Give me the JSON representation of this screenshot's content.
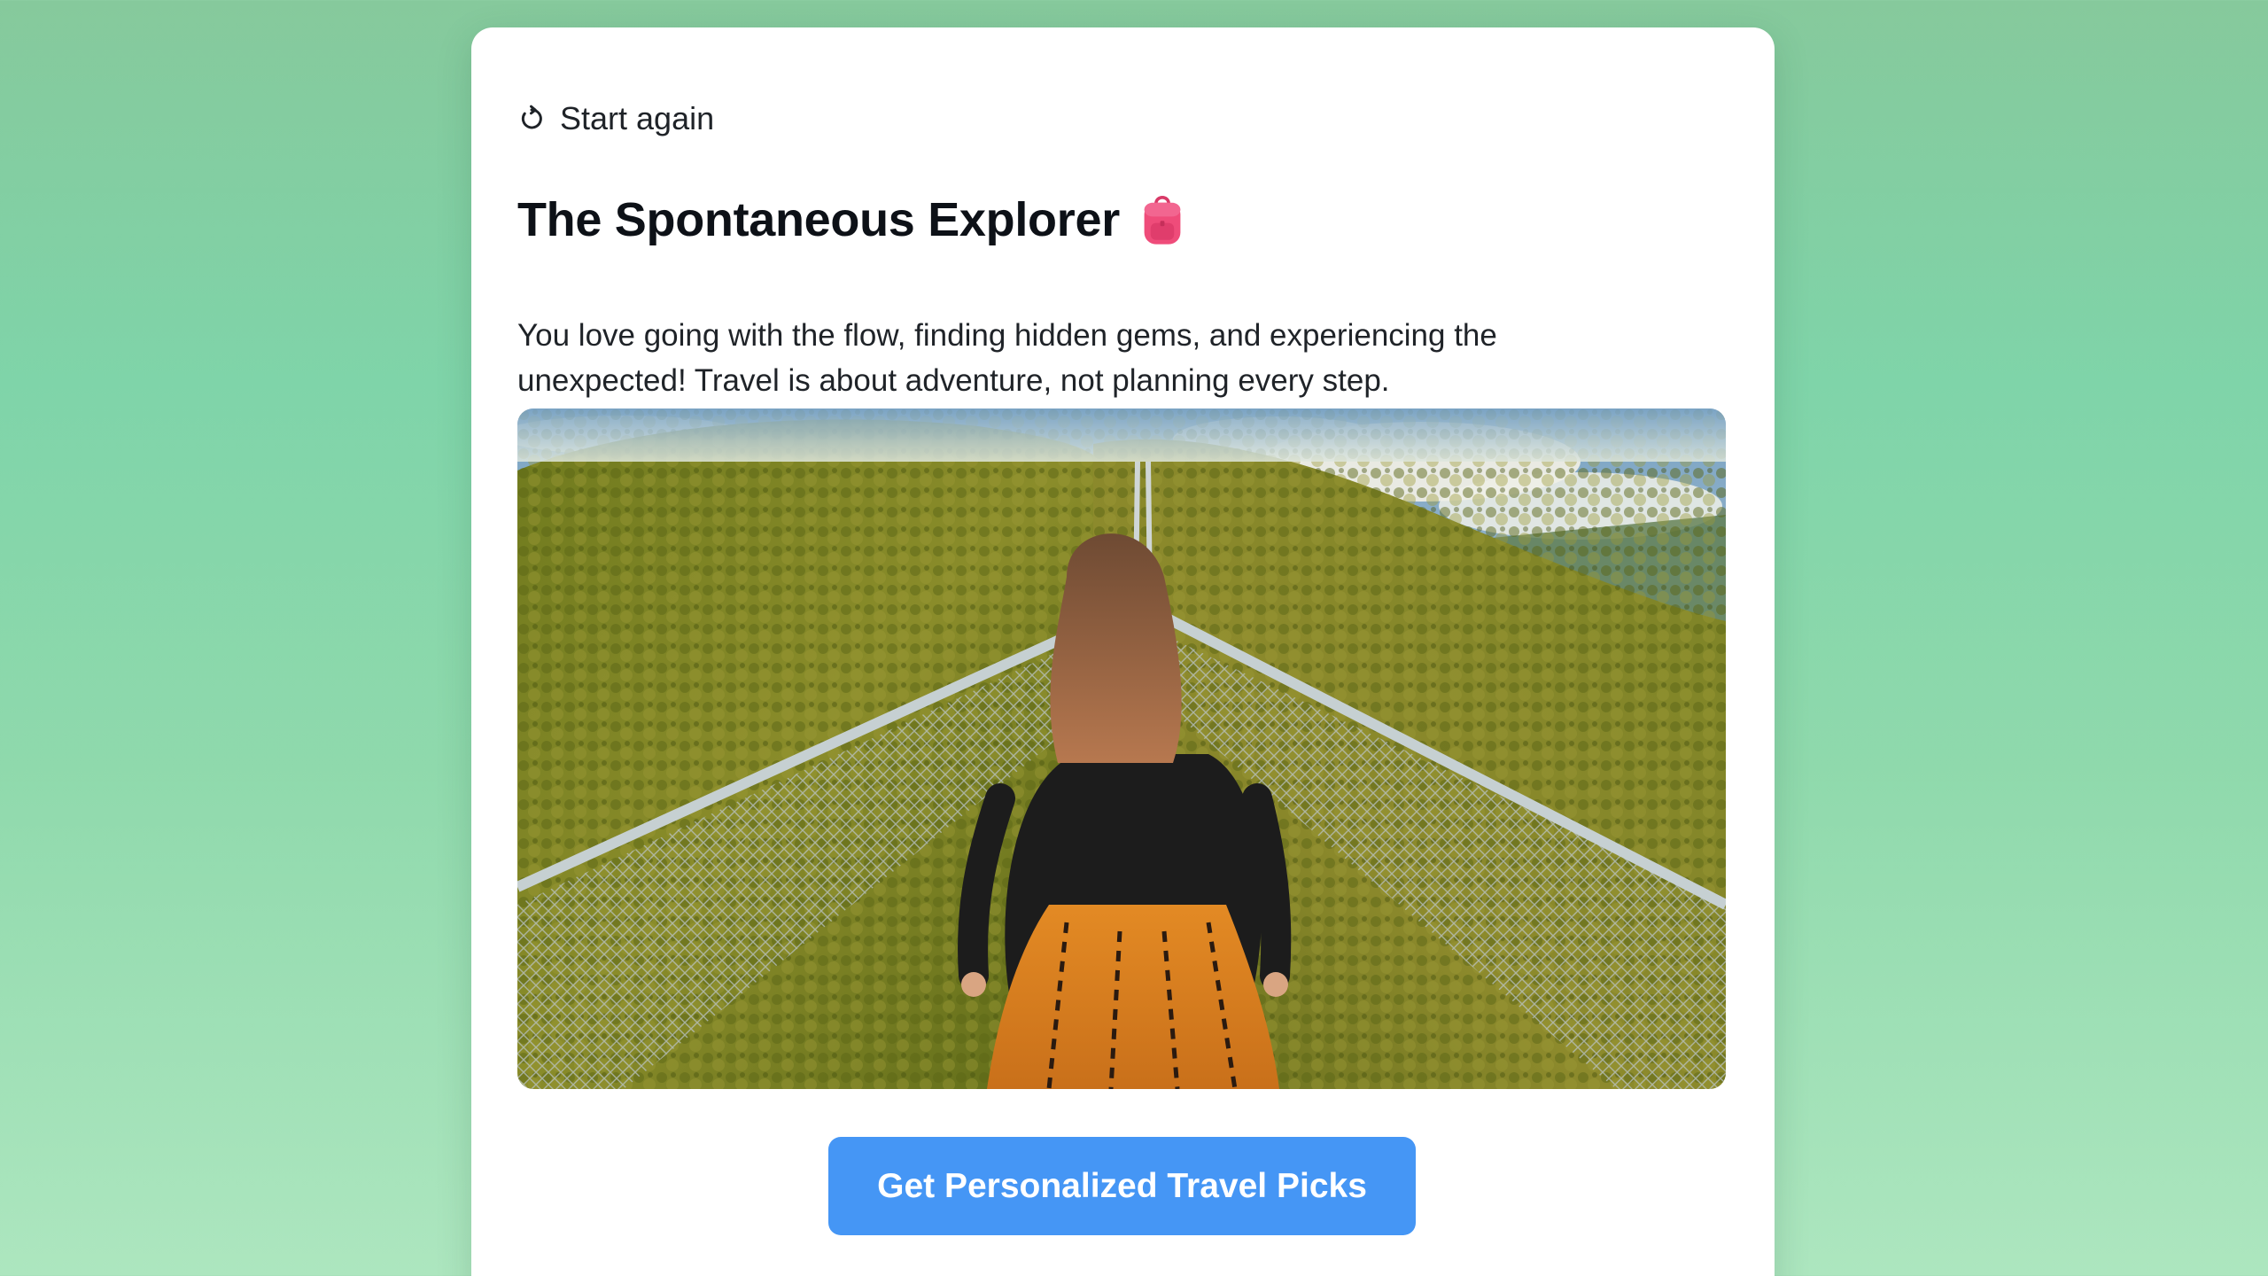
{
  "result": {
    "restart_label": "Start again",
    "restart_icon": "restart-arrow-icon",
    "title": "The Spontaneous Explorer",
    "title_icon": "backpack-icon",
    "description": "You love going with the flow, finding hidden gems, and experiencing the unexpected! Travel is about adventure, not planning every step.",
    "image_icon": "suspension-bridge-photo",
    "cta_label": "Get Personalized Travel Picks"
  },
  "colors": {
    "background_top": "#86c99c",
    "background_bottom": "#ade6bf",
    "card": "#ffffff",
    "cta": "#4596f5",
    "backpack": "#ef4c7a"
  }
}
